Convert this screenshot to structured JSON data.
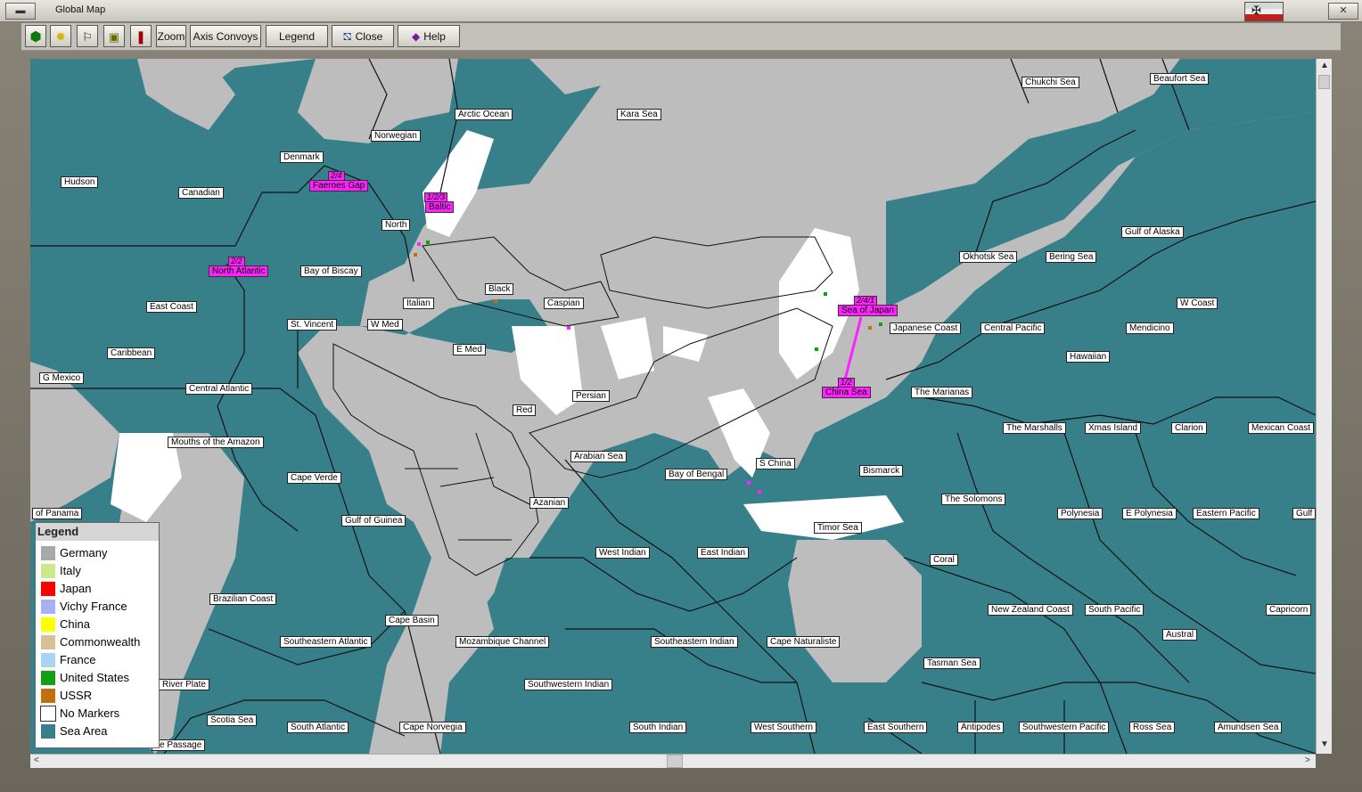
{
  "window": {
    "title": "Global Map",
    "close_glyph": "✕"
  },
  "toolbar": {
    "icon_buttons": [
      "hexagon",
      "star",
      "flag",
      "document",
      "lever"
    ],
    "zoom_label": "Zoom",
    "axis_convoys_label": "Axis Convoys",
    "legend_label": "Legend",
    "close_label": "Close",
    "help_label": "Help"
  },
  "colors": {
    "sea": "#37808a",
    "land": "#bdbdbd",
    "no_markers": "#ffffff",
    "hot_zone": "#ff22ff"
  },
  "sea_areas": [
    "Chukchi Sea",
    "Beaufort Sea",
    "Arctic Ocean",
    "Kara Sea",
    "Norwegian",
    "Denmark",
    "Hudson",
    "Canadian",
    "Faeroes Gap",
    "Baltic",
    "North",
    "North Atlantic",
    "Bay of Biscay",
    "Black",
    "Caspian",
    "Italian",
    "East Coast",
    "St. Vincent",
    "W Med",
    "E Med",
    "Caribbean",
    "G Mexico",
    "Central Atlantic",
    "Persian",
    "Red",
    "Mouths of the Amazon",
    "Arabian Sea",
    "Cape Verde",
    "of Panama",
    "Gulf of Guinea",
    "Azanian",
    "Bay of Bengal",
    "S China",
    "West Indian",
    "East Indian",
    "Brazilian Coast",
    "Cape Basin",
    "Southeastern Atlantic",
    "Mozambique Channel",
    "Southeastern Indian",
    "Cape Naturaliste",
    "Southwestern Indian",
    "River Plate",
    "Scotia Sea",
    "South Atlantic",
    "Cape Norvegia",
    "South Indian",
    "West Southern",
    "East Southern",
    "Antipodes",
    "Southwestern Pacific",
    "Ross Sea",
    "Amundsen Sea",
    "ke Passage",
    "Okhotsk Sea",
    "Bering Sea",
    "Gulf of Alaska",
    "W Coast",
    "Sea of Japan",
    "Japanese Coast",
    "Central Pacific",
    "Mendicino",
    "Hawaiian",
    "China Sea",
    "The Marianas",
    "The Marshalls",
    "Xmas Island",
    "Clarion",
    "Mexican Coast",
    "Bismarck",
    "The Solomons",
    "Polynesia",
    "E Polynesia",
    "Eastern Pacific",
    "Gulf",
    "Timor Sea",
    "Coral",
    "New Zealand Coast",
    "South Pacific",
    "Capricorn",
    "Austral",
    "Tasman Sea"
  ],
  "hot_areas": [
    {
      "name": "Faeroes Gap",
      "count": "2/4"
    },
    {
      "name": "Baltic",
      "count": "1/2/3"
    },
    {
      "name": "North Atlantic",
      "count": "2/2"
    },
    {
      "name": "Sea of Japan",
      "count": "2/4/1"
    },
    {
      "name": "China Sea",
      "count": "1/2"
    }
  ],
  "legend": {
    "title": "Legend",
    "items": [
      {
        "label": "Germany",
        "color": "#a9a9a9"
      },
      {
        "label": "Italy",
        "color": "#cce88a"
      },
      {
        "label": "Japan",
        "color": "#ff0000"
      },
      {
        "label": "Vichy France",
        "color": "#a8b0f0"
      },
      {
        "label": "China",
        "color": "#ffff00"
      },
      {
        "label": "Commonwealth",
        "color": "#d8bf95"
      },
      {
        "label": "France",
        "color": "#a8d4f0"
      },
      {
        "label": "United States",
        "color": "#10a010"
      },
      {
        "label": "USSR",
        "color": "#c07010"
      },
      {
        "label": "No Markers",
        "color": "#ffffff"
      },
      {
        "label": "Sea Area",
        "color": "#37808a"
      }
    ]
  },
  "scroll": {
    "up": "▲",
    "down": "▼",
    "left": "<",
    "right": ">"
  }
}
